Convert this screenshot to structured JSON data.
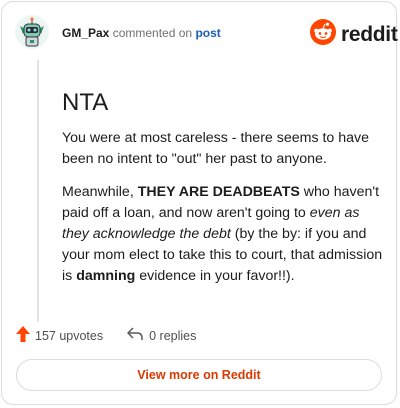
{
  "header": {
    "username": "GM_Pax",
    "action_text": "commented on",
    "post_link": "post",
    "brand": "reddit",
    "avatar_icon": "robot-avatar-icon",
    "logo_icon": "reddit-alien-icon",
    "brand_color": "#ff4500"
  },
  "comment": {
    "heading": "NTA",
    "para1": "You were at most careless - there seems to have been no intent to \"out\" her past to anyone.",
    "para2": {
      "t1": "Meanwhile, ",
      "b1": "THEY ARE DEADBEATS",
      "t2": " who haven't paid off a loan, and now aren't going to ",
      "i1": "even as they acknowledge the debt",
      "t3": " (by the by: if you and your mom elect to take this to court, that admission is ",
      "b2": "damning",
      "t4": " evidence in your favor!!)."
    }
  },
  "footer": {
    "upvotes": "157 upvotes",
    "replies": "0 replies",
    "upvote_icon": "upvote-arrow-icon",
    "reply_icon": "reply-arrow-icon",
    "upvote_color": "#ff4500"
  },
  "view_more": "View more on Reddit",
  "view_more_color": "#d93a00"
}
